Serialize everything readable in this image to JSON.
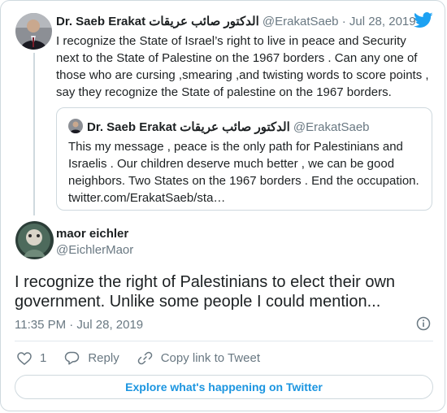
{
  "primary_tweet": {
    "name": "Dr. Saeb Erakat الدكتور صائب عريقات",
    "handle": "@ErakatSaeb",
    "separator": "·",
    "date": "Jul 28, 2019",
    "text": "I recognize the State of Israel’s right to live in peace and Security next to the State of Palestine on the 1967 borders . Can any one of those who are cursing ,smearing ,and twisting words to score points , say they recognize the State of palestine  on the 1967 borders."
  },
  "quoted_tweet": {
    "name": "Dr. Saeb Erakat الدكتور صائب عريقات",
    "handle": "@ErakatSaeb",
    "text": "This my message , peace is the only path for Palestinians and Israelis . Our children deserve much better , we can be good neighbors. Two States on the 1967 borders . End the occupation. twitter.com/ErakatSaeb/sta…"
  },
  "reply_tweet": {
    "name": "maor eichler",
    "handle": "@EichlerMaor",
    "text": "I recognize the right of Palestinians to elect their own government. Unlike some people I could mention...",
    "timestamp": "11:35 PM · Jul 28, 2019"
  },
  "actions": {
    "like_count": "1",
    "reply_label": "Reply",
    "copy_label": "Copy link to Tweet"
  },
  "footer": {
    "explore_label": "Explore what's happening on Twitter"
  },
  "colors": {
    "twitter_blue": "#1da1f2",
    "link_blue": "#1b95e0",
    "muted": "#697882"
  }
}
